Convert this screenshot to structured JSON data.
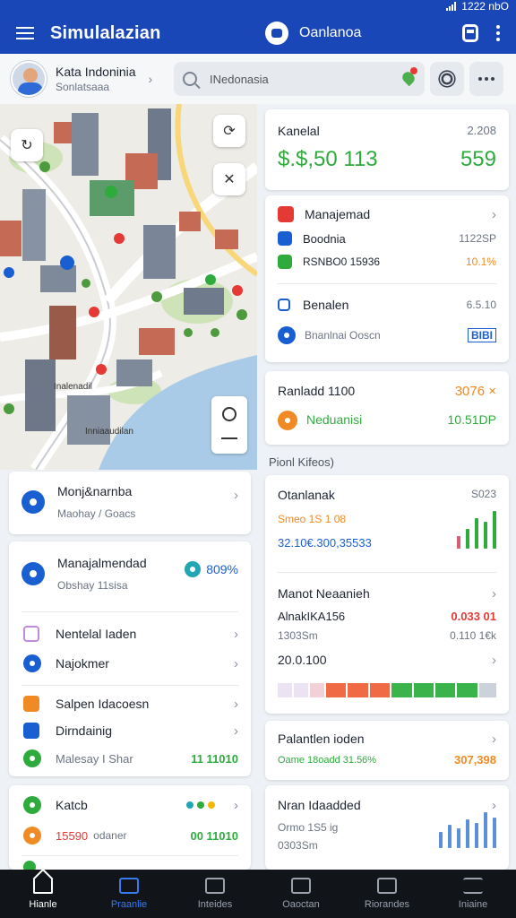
{
  "status": {
    "time": "1222 nbO"
  },
  "appbar": {
    "title": "Simulalazian",
    "center_label": "Oanlanoa"
  },
  "profile": {
    "name": "Kata Indoninia",
    "subtitle": "Sonlatsaaa"
  },
  "search": {
    "value": "INedonasia"
  },
  "map": {
    "labels": [
      "Inalenadil",
      "Inniaaudilan"
    ]
  },
  "left_cards": {
    "card1": {
      "title": "Monj&narnba",
      "subtitle": "Maohay / Goacs"
    },
    "card2": {
      "title": "Manajalmendad",
      "subtitle": "Obshay 11sisa",
      "badge": "809%",
      "items": [
        {
          "label": "Nentelal Iaden"
        },
        {
          "label": "Najokmer"
        },
        {
          "label": "Salpen Idacoesn"
        },
        {
          "label": "Dirndainig"
        },
        {
          "label": "Malesay I Shar",
          "value": "11 11010"
        }
      ]
    },
    "card3": {
      "title": "Katcb",
      "item_label": "odaner",
      "item_prefix": "15590",
      "value": "00 11010"
    }
  },
  "right_cards": {
    "rc1": {
      "label": "Kanelal",
      "small": "2.208",
      "amount": "$.$,50 113",
      "value": "559"
    },
    "rc2": {
      "title": "Manajemad",
      "rows": [
        {
          "label": "Boodnia",
          "value": "1122SP"
        },
        {
          "label": "RSNBO0 15936",
          "value": "10.1%"
        }
      ],
      "section_label": "Benalen",
      "section_value": "6.5.10",
      "foot_label": "Bnanlnai Ooscn",
      "foot_value": "BIBI"
    },
    "rc3": {
      "label": "Ranladd 1100",
      "value": "3076 ×",
      "sub_label": "Neduanisi",
      "sub_value": "10.51DP"
    },
    "section_title": "Pionl Kifeos)",
    "rc4": {
      "title": "Otanlanak",
      "corner": "S023",
      "line1": "Smeo 1S 1 08",
      "line2": "32.10€.300,35533",
      "title2": "Manot Neaanieh",
      "line3": "AlnakIKA156",
      "line3_value": "0.033 01",
      "line4": "1303Sm",
      "line4_value": "0.110 1€k",
      "line5": "20.0.100"
    },
    "rc5": {
      "title": "Palantlen ioden",
      "left": "Oame 18oadd 31.56%",
      "right": "307,398"
    },
    "rc6": {
      "title": "Nran Idaadded",
      "line1": "Ormo 1S5 ig",
      "line2": "0303Sm"
    }
  },
  "bottom_nav": [
    "Hianle",
    "Praanlie",
    "Inteides",
    "Oaoctan",
    "Riorandes",
    "Iniaine"
  ],
  "colors": {
    "primary": "#1a47b8",
    "green": "#2fab3e",
    "orange": "#f08a24",
    "red": "#e53935"
  }
}
